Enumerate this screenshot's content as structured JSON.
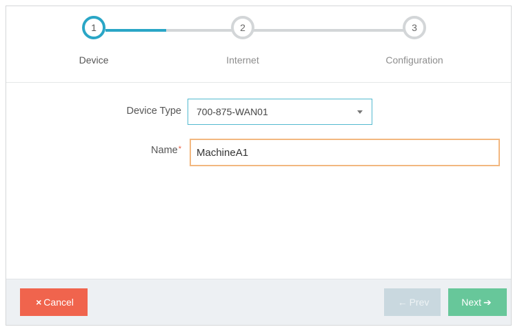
{
  "stepper": {
    "steps": [
      {
        "number": "1",
        "label": "Device",
        "state": "active"
      },
      {
        "number": "2",
        "label": "Internet",
        "state": "pending"
      },
      {
        "number": "3",
        "label": "Configuration",
        "state": "pending"
      }
    ]
  },
  "form": {
    "device_type": {
      "label": "Device Type",
      "selected": "700-875-WAN01"
    },
    "name": {
      "label": "Name",
      "required_marker": "*",
      "value": "MachineA1"
    }
  },
  "footer": {
    "cancel_icon": "×",
    "cancel_label": "Cancel",
    "prev_icon": "←",
    "prev_label": "Prev",
    "next_label": "Next",
    "next_icon": "➔"
  },
  "colors": {
    "accent": "#2aa6c6",
    "cancel": "#f0644d",
    "next": "#67c79a",
    "prev_disabled": "#c9d8df",
    "name_focus_border": "#f2b77f"
  }
}
